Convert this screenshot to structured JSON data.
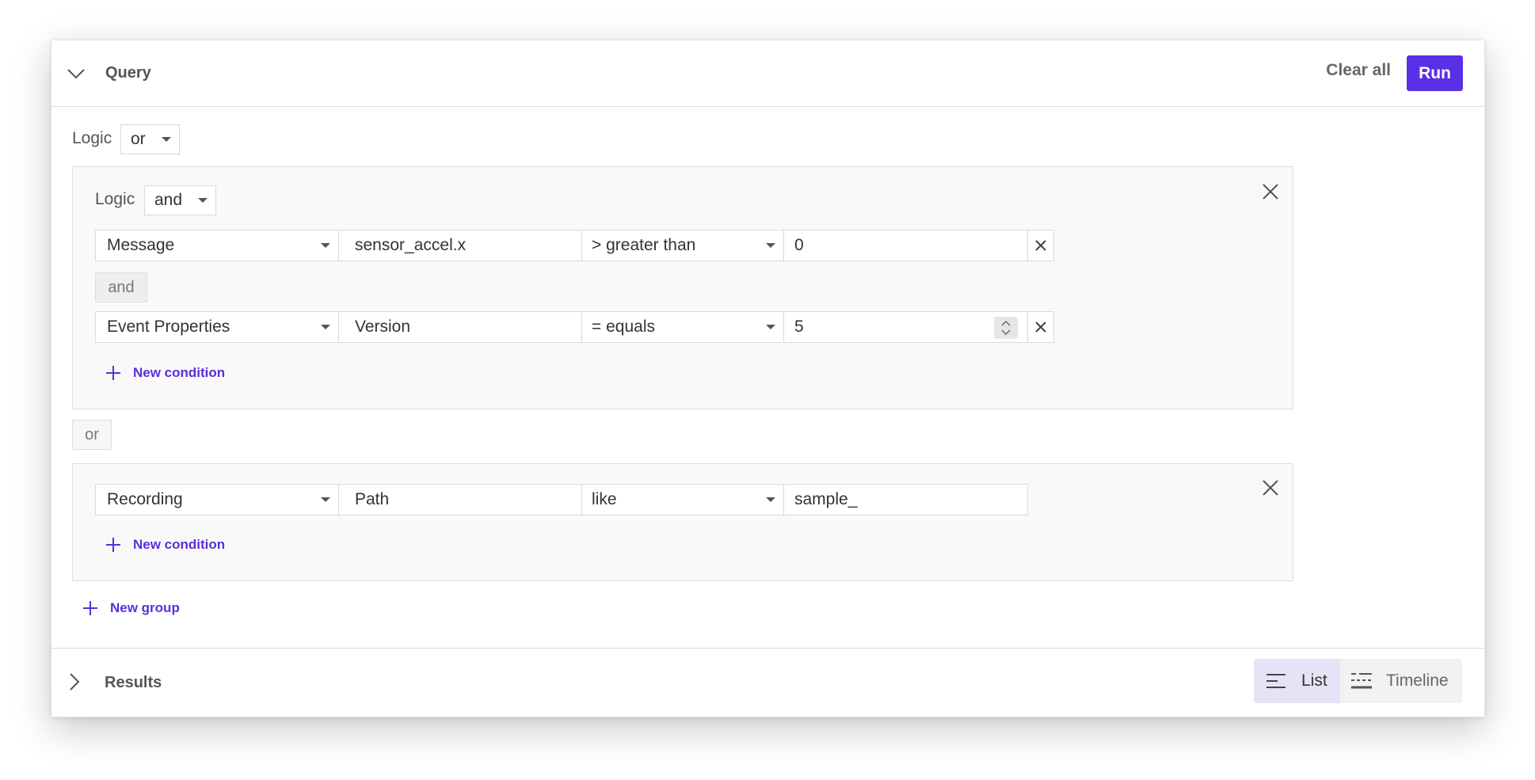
{
  "query": {
    "title": "Query",
    "clear_label": "Clear all",
    "run_label": "Run",
    "logic_label": "Logic",
    "root_logic": "or",
    "groups": [
      {
        "logic_label": "Logic",
        "logic": "and",
        "conditions": [
          {
            "field": "Message",
            "key": "sensor_accel.x",
            "operator": "> greater than",
            "value": "0"
          },
          {
            "field": "Event Properties",
            "key": "Version",
            "operator": "= equals",
            "value": "5"
          }
        ],
        "connector": "and",
        "new_condition_label": "New condition"
      },
      {
        "conditions": [
          {
            "field": "Recording",
            "key": "Path",
            "operator": "like",
            "value": "sample_"
          }
        ],
        "new_condition_label": "New condition"
      }
    ],
    "group_connector": "or",
    "new_group_label": "New group"
  },
  "results": {
    "title": "Results",
    "views": [
      {
        "label": "List",
        "icon": "list-icon",
        "active": true
      },
      {
        "label": "Timeline",
        "icon": "timeline-icon",
        "active": false
      }
    ]
  },
  "colors": {
    "accent": "#5a2fe6",
    "link": "#5a2fd6",
    "active_view_bg": "#e7e3f6"
  }
}
